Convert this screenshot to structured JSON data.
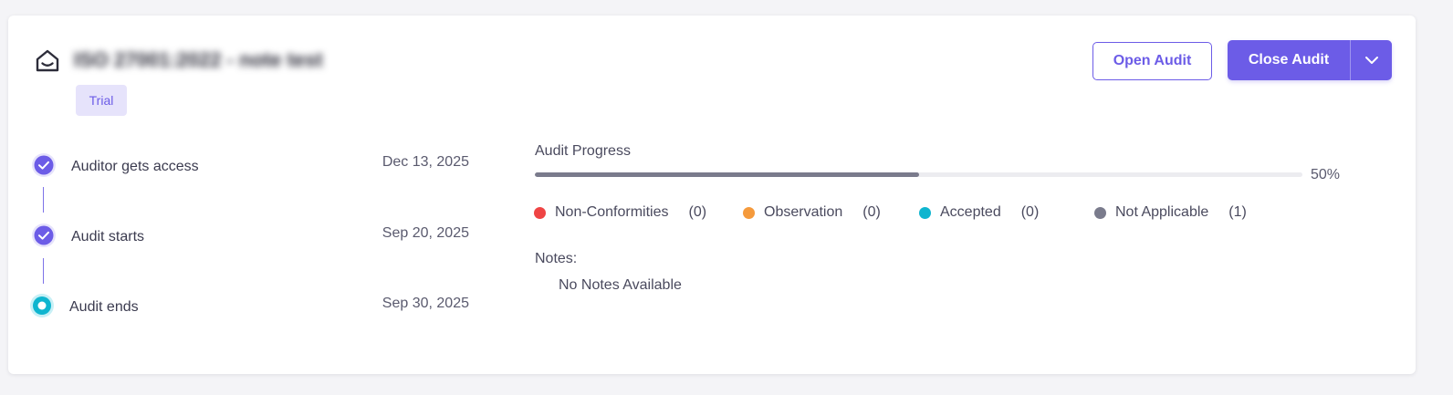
{
  "header": {
    "title": "ISO 27001:2022 - note test",
    "badge": "Trial",
    "open_audit_label": "Open Audit",
    "close_audit_label": "Close Audit"
  },
  "timeline": [
    {
      "label": "Auditor gets access",
      "date": "Dec 13, 2025",
      "status": "completed"
    },
    {
      "label": "Audit starts",
      "date": "Sep 20, 2025",
      "status": "completed"
    },
    {
      "label": "Audit ends",
      "date": "Sep 30, 2025",
      "status": "current"
    }
  ],
  "progress": {
    "label": "Audit Progress",
    "value": 50,
    "display": "50%"
  },
  "legend": [
    {
      "label": "Non-Conformities",
      "count": "(0)",
      "color": "#ef4444"
    },
    {
      "label": "Observation",
      "count": "(0)",
      "color": "#f59a3c"
    },
    {
      "label": "Accepted",
      "count": "(0)",
      "color": "#0fb5cf"
    },
    {
      "label": "Not Applicable",
      "count": "(1)",
      "color": "#7a7b8c"
    }
  ],
  "notes": {
    "label": "Notes:",
    "empty_text": "No Notes Available"
  },
  "colors": {
    "accent": "#6c5ce7",
    "current_step": "#0fb5cf"
  }
}
